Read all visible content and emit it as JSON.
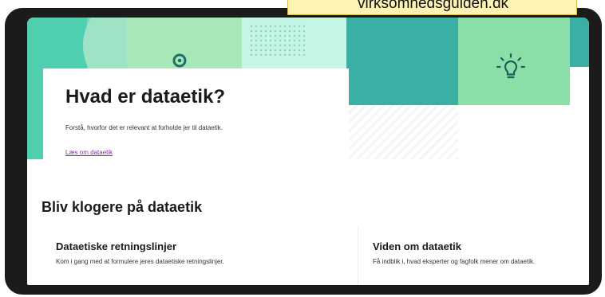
{
  "badge": {
    "text": "virksomhedsguiden.dk"
  },
  "hero": {
    "title": "Hvad er dataetik?",
    "description": "Forstå, hvorfor det er relevant at forholde jer til dataetik.",
    "link_label": "Læs om dataetik"
  },
  "section": {
    "title": "Bliv klogere på dataetik",
    "tiles": [
      {
        "title": "Dataetiske retningslinjer",
        "description": "Kom i gang med at formulere jeres dataetiske retningslinjer."
      },
      {
        "title": "Viden om dataetik",
        "description": "Få indblik i, hvad eksperter og fagfolk mener om dataetik."
      }
    ]
  },
  "icons": {
    "pin": "location-pin-icon",
    "bulb": "lightbulb-icon"
  },
  "colors": {
    "teal": "#3ab0a4",
    "mint": "#4fcfb0",
    "light_green": "#8adfa8",
    "link": "#8a2bb0",
    "badge_bg": "#fff3b3"
  }
}
